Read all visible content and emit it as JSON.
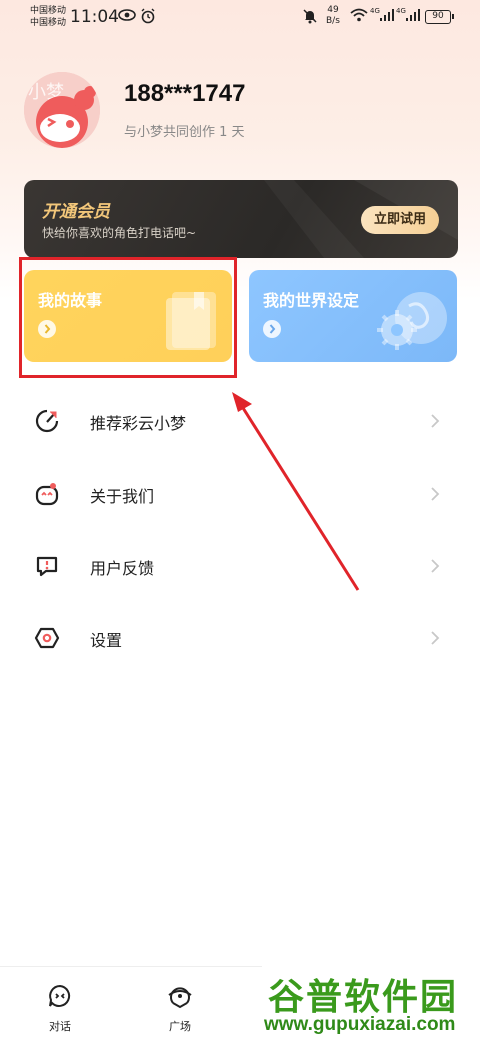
{
  "status_bar": {
    "carrier_1": "中国移动",
    "carrier_2": "中国移动",
    "time": "11:04",
    "speed_value": "49",
    "speed_unit": "B/s",
    "network_1": "4G",
    "network_2": "4G",
    "battery": "90"
  },
  "profile": {
    "username": "188***1747",
    "subtitle": "与小梦共同创作 1 天",
    "avatar_text": "小梦"
  },
  "vip": {
    "title": "开通会员",
    "subtitle": "快给你喜欢的角色打电话吧~",
    "button": "立即试用"
  },
  "cards": {
    "story": {
      "title": "我的故事"
    },
    "world": {
      "title": "我的世界设定"
    }
  },
  "menu": [
    {
      "label": "推荐彩云小梦",
      "icon": "share-icon"
    },
    {
      "label": "关于我们",
      "icon": "mascot-icon"
    },
    {
      "label": "用户反馈",
      "icon": "feedback-icon"
    },
    {
      "label": "设置",
      "icon": "settings-icon"
    }
  ],
  "bottom_nav": [
    {
      "label": "对话",
      "icon": "chat-icon"
    },
    {
      "label": "广场",
      "icon": "square-icon"
    }
  ],
  "watermark": {
    "title": "谷普软件园",
    "url": "www.gupuxiazai.com"
  },
  "colors": {
    "highlight": "#e0242a",
    "story_card": "#ffd45c",
    "world_card": "#8ec6ff",
    "vip_gold": "#f3c77a"
  }
}
